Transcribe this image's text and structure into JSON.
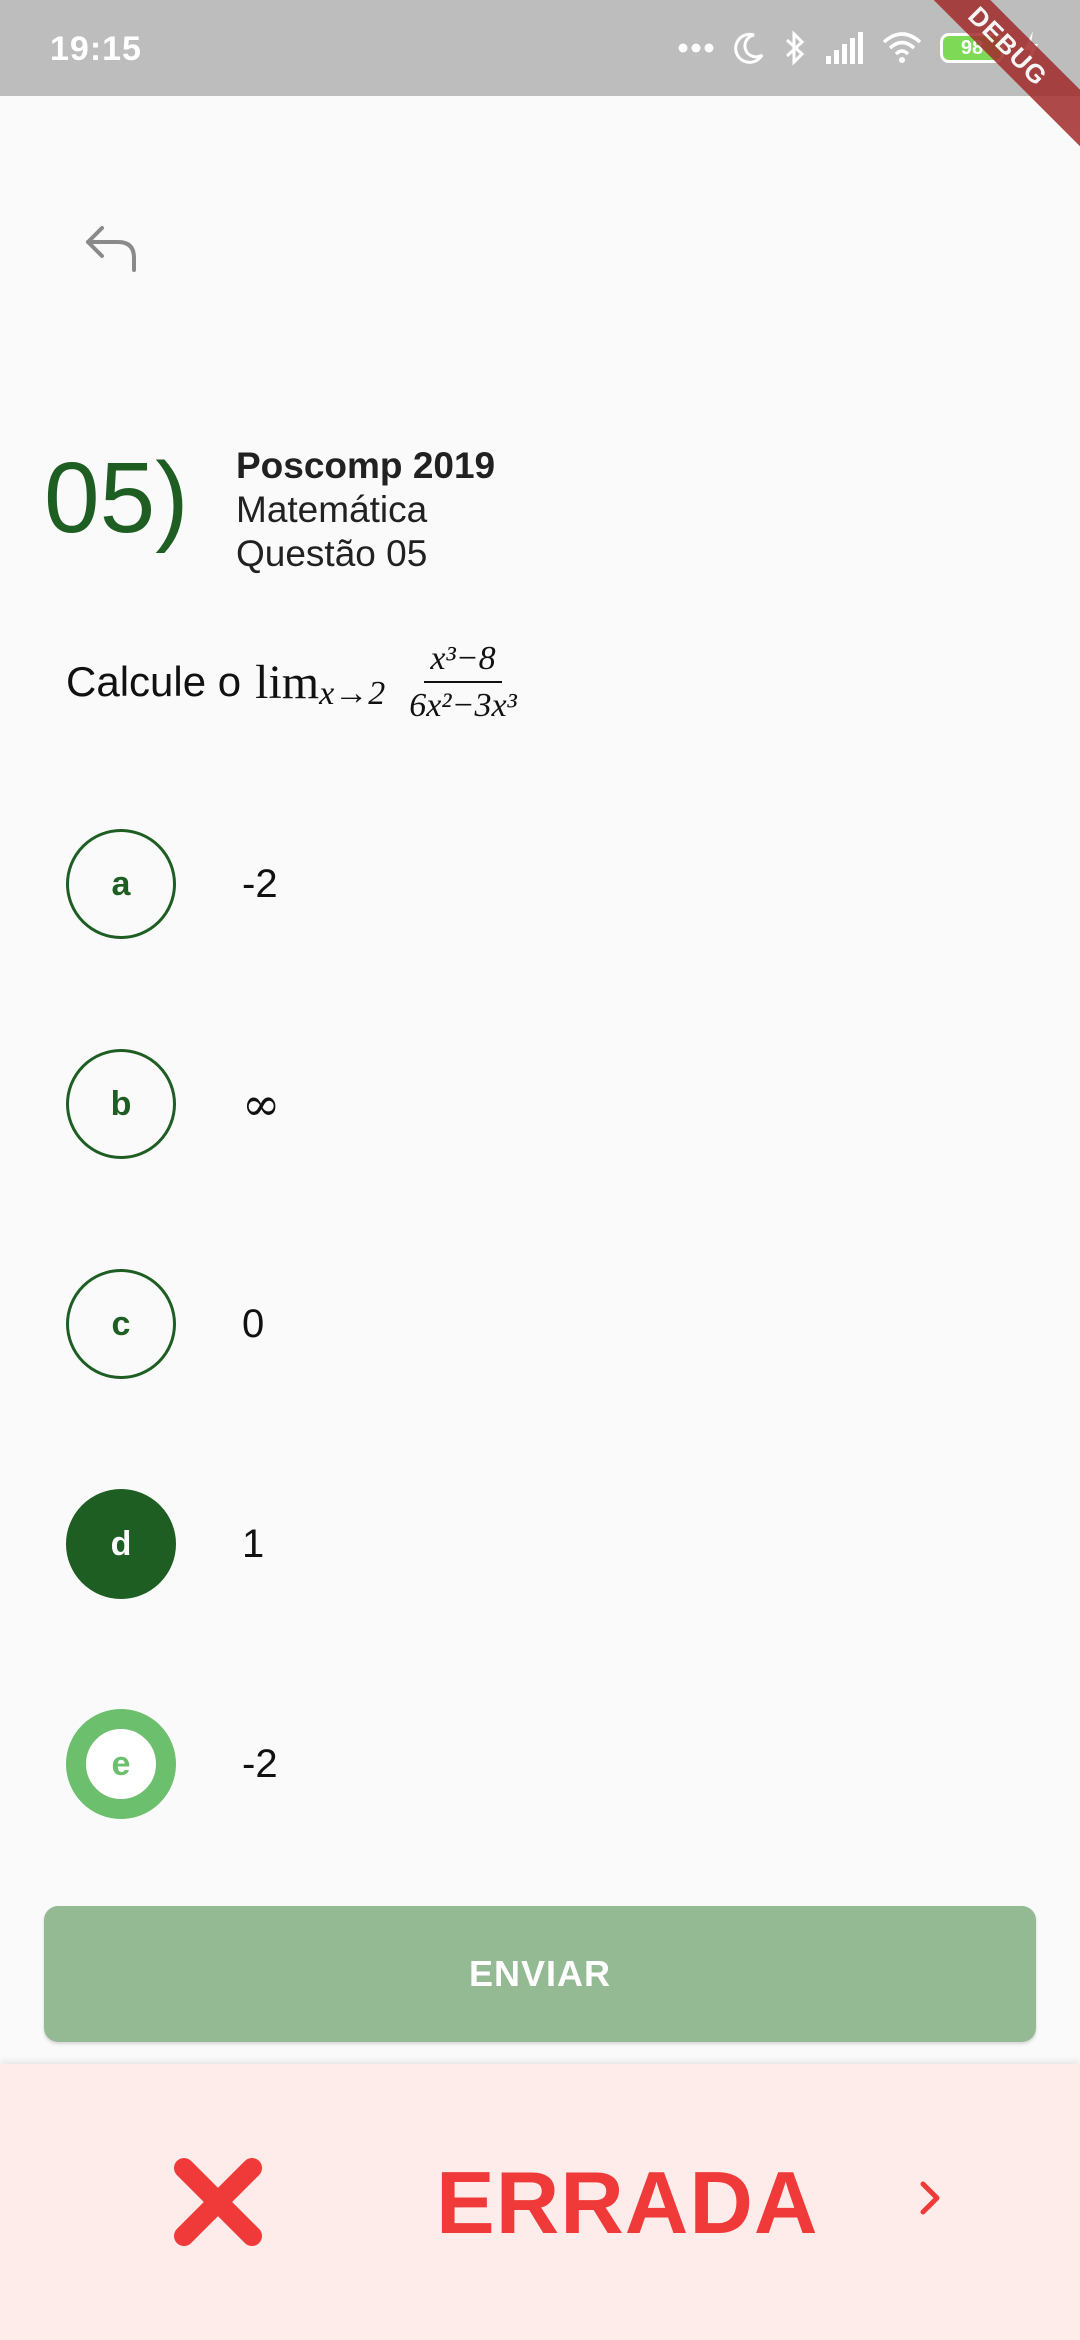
{
  "status_bar": {
    "time": "19:15",
    "battery": "98",
    "icons": [
      "more-dots-icon",
      "moon-icon",
      "bluetooth-icon",
      "signal-icon",
      "wifi-icon",
      "battery-icon",
      "charging-icon"
    ]
  },
  "debug_banner": "DEBUG",
  "question": {
    "number": "05)",
    "exam": "Poscomp 2019",
    "subject": "Matemática",
    "label": "Questão 05",
    "statement_text": "Calcule o",
    "limit": {
      "word": "lim",
      "subscript": "x→2",
      "numerator": "x³−8",
      "denominator": "6x²−3x³"
    }
  },
  "options": [
    {
      "letter": "a",
      "value": "-2",
      "state": "default"
    },
    {
      "letter": "b",
      "value": "∞",
      "state": "default"
    },
    {
      "letter": "c",
      "value": "0",
      "state": "default"
    },
    {
      "letter": "d",
      "value": "1",
      "state": "selected"
    },
    {
      "letter": "e",
      "value": "-2",
      "state": "correct"
    }
  ],
  "submit_label": "ENVIAR",
  "result": {
    "label": "ERRADA",
    "color": "#f03a3a",
    "background": "#fdecea"
  },
  "colors": {
    "primary": "#1e5e22",
    "correct": "#6cbf6c",
    "submit": "#94ba94",
    "wrong": "#f03a3a"
  }
}
